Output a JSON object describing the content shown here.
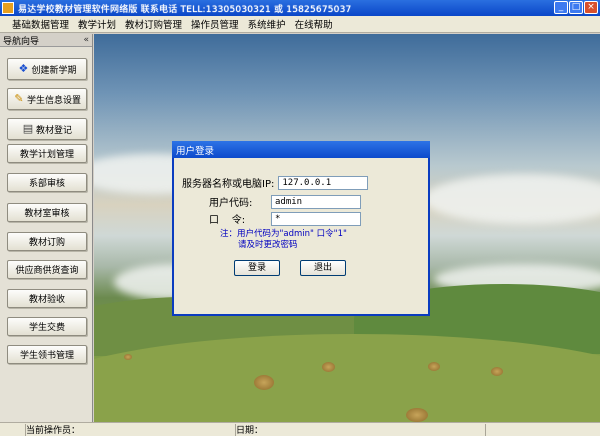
{
  "window": {
    "title": "易达学校教材管理软件网络版 联系电话 TELL:13305030321 或 15825675037",
    "min_label": "_",
    "max_label": "□",
    "close_label": "×"
  },
  "menubar": {
    "items": [
      "基础数据管理",
      "教学计划",
      "教材订购管理",
      "操作员管理",
      "系统维护",
      "在线帮助"
    ]
  },
  "sidebar": {
    "header": "导航向导",
    "collapse": "«",
    "items": [
      {
        "label": "创建新学期",
        "icon": "book-blue-icon",
        "glyph": "❖"
      },
      {
        "label": "学生信息设置",
        "icon": "notepad-icon",
        "glyph": "✎"
      },
      {
        "label": "教材登记",
        "icon": "book-icon",
        "glyph": "▤"
      },
      {
        "label": "教学计划管理"
      },
      {
        "label": "系部审核"
      },
      {
        "label": "教材室审核"
      },
      {
        "label": "教材订购"
      },
      {
        "label": "供应商供货查询"
      },
      {
        "label": "教材验收"
      },
      {
        "label": "学生交费"
      },
      {
        "label": "学生领书管理"
      }
    ]
  },
  "dialog": {
    "title": "用户登录",
    "server_label": "服务器名称或电脑IP:",
    "server_value": "127.0.0.1",
    "user_label": "用户代码:",
    "user_value": "admin",
    "pass_label": "口    令:",
    "pass_value": "*",
    "note_line1": "注：用户代码为\"admin\" 口令\"1\"",
    "note_line2": "请及时更改密码",
    "login_button": "登录",
    "exit_button": "退出"
  },
  "statusbar": {
    "operator_label": "当前操作员：",
    "date_label": "日期："
  }
}
